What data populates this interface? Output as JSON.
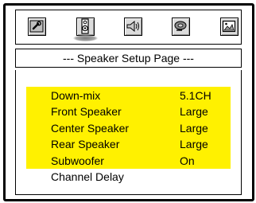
{
  "toolbar": {
    "icons": [
      {
        "name": "wrench-icon",
        "label": "General Setup"
      },
      {
        "name": "speaker-icon",
        "label": "Speaker Setup",
        "active": true
      },
      {
        "name": "audio-speaker-icon",
        "label": "Audio Setup"
      },
      {
        "name": "disc-icon",
        "label": "Video Setup"
      },
      {
        "name": "image-icon",
        "label": "Preference"
      }
    ]
  },
  "page": {
    "title": "--- Speaker Setup Page ---"
  },
  "menu": {
    "items": [
      {
        "label": "Down-mix",
        "value": "5.1CH",
        "highlighted": true
      },
      {
        "label": "Front Speaker",
        "value": "Large",
        "highlighted": true
      },
      {
        "label": "Center Speaker",
        "value": "Large",
        "highlighted": true
      },
      {
        "label": "Rear Speaker",
        "value": "Large",
        "highlighted": true
      },
      {
        "label": "Subwoofer",
        "value": "On",
        "highlighted": true
      },
      {
        "label": "Channel Delay",
        "value": "",
        "highlighted": false
      }
    ]
  },
  "colors": {
    "highlight": "#fff100",
    "border": "#000000",
    "icon_face": "#dcdcdc"
  }
}
